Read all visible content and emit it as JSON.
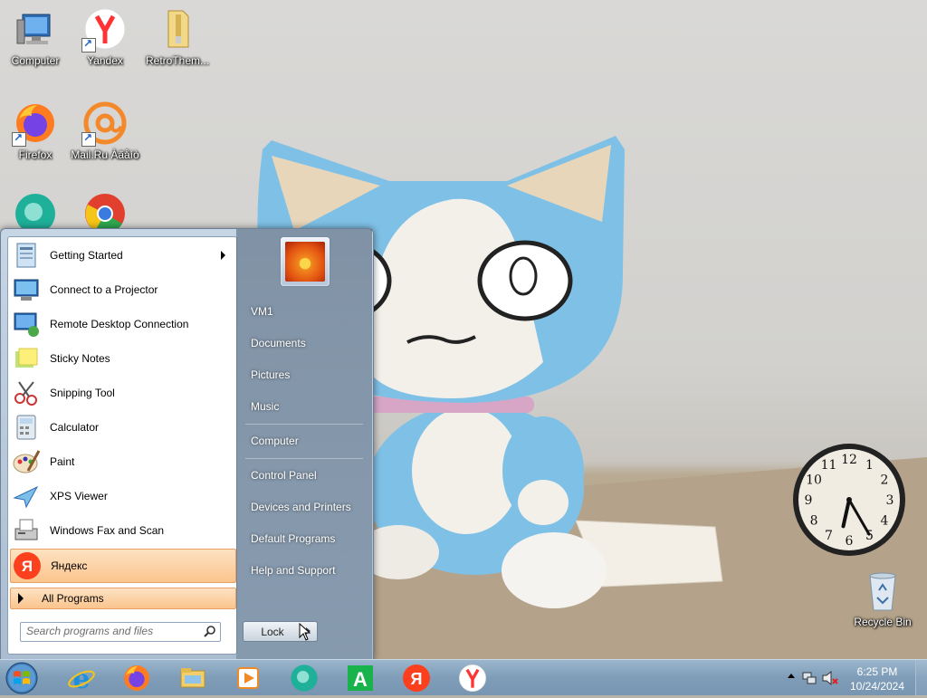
{
  "desktop": {
    "icons": [
      {
        "label": "Computer",
        "icon": "computer-icon"
      },
      {
        "label": "Yandex",
        "icon": "yandex-browser-icon"
      },
      {
        "label": "RetroThem...",
        "icon": "folder-icon"
      },
      {
        "label": "Firefox",
        "icon": "firefox-icon"
      },
      {
        "label": "Mail.Ru Àãåíò",
        "icon": "mailru-agent-icon"
      },
      {
        "label": "",
        "icon": "app-icon"
      },
      {
        "label": "",
        "icon": "chrome-icon"
      },
      {
        "label": "Recycle Bin",
        "icon": "recycle-bin-icon"
      }
    ]
  },
  "clock_gadget": {
    "numbers": [
      "12",
      "1",
      "2",
      "3",
      "4",
      "5",
      "6",
      "7",
      "8",
      "9",
      "10",
      "11"
    ],
    "time": "6:25"
  },
  "start_menu": {
    "programs": [
      {
        "label": "Getting Started",
        "icon": "getting-started-icon",
        "submenu": true
      },
      {
        "label": "Connect to a Projector",
        "icon": "projector-icon"
      },
      {
        "label": "Remote Desktop Connection",
        "icon": "remote-desktop-icon"
      },
      {
        "label": "Sticky Notes",
        "icon": "sticky-notes-icon"
      },
      {
        "label": "Snipping Tool",
        "icon": "snipping-tool-icon"
      },
      {
        "label": "Calculator",
        "icon": "calculator-icon"
      },
      {
        "label": "Paint",
        "icon": "paint-icon"
      },
      {
        "label": "XPS Viewer",
        "icon": "xps-viewer-icon"
      },
      {
        "label": "Windows Fax and Scan",
        "icon": "fax-scan-icon"
      },
      {
        "label": "Яндекс",
        "icon": "yandex-icon",
        "highlighted": true
      }
    ],
    "all_programs": "All Programs",
    "search_placeholder": "Search programs and files",
    "right_links": [
      "VM1",
      "Documents",
      "Pictures",
      "Music",
      "Computer",
      "Control Panel",
      "Devices and Printers",
      "Default Programs",
      "Help and Support"
    ],
    "lock_label": "Lock"
  },
  "taskbar": {
    "pinned": [
      "ie-icon",
      "firefox-icon",
      "explorer-icon",
      "media-player-icon",
      "app-icon",
      "aimp-icon",
      "yandex-icon",
      "yandex-browser-icon"
    ],
    "time": "6:25 PM",
    "date": "10/24/2024"
  }
}
